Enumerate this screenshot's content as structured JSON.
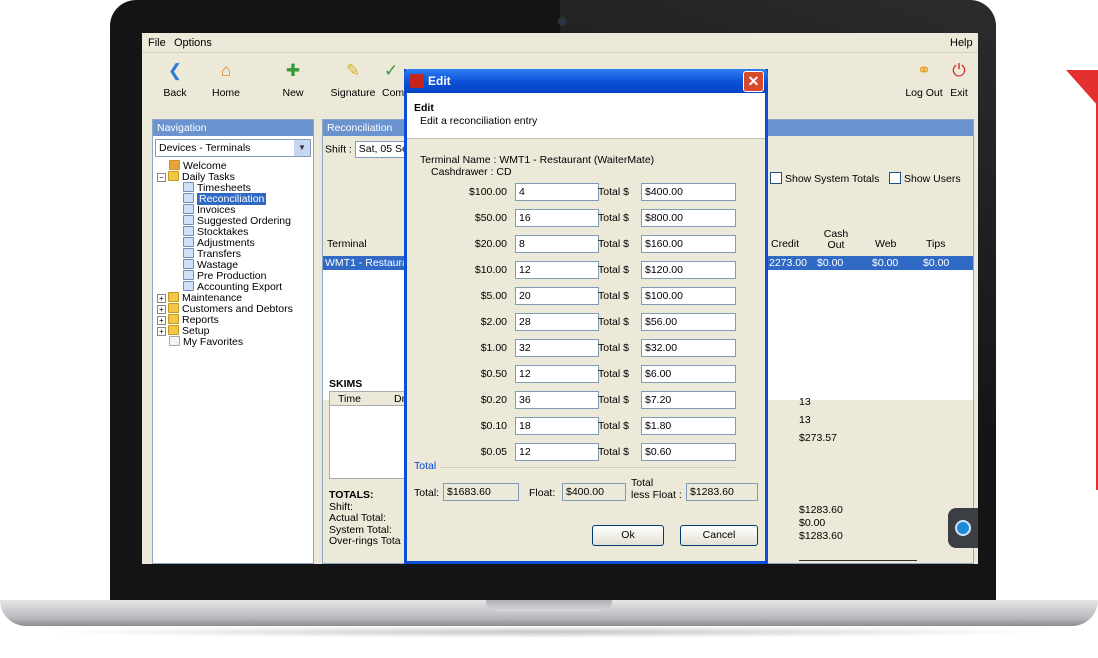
{
  "menubar": {
    "file": "File",
    "options": "Options",
    "help": "Help"
  },
  "toolbar": {
    "back": "Back",
    "home": "Home",
    "new": "New",
    "signature": "Signature",
    "com": "Com",
    "logout": "Log Out",
    "exit": "Exit"
  },
  "nav": {
    "header": "Navigation",
    "dropdown_value": "Devices - Terminals",
    "items": [
      "Welcome",
      "Daily Tasks",
      "Timesheets",
      "Reconciliation",
      "Invoices",
      "Suggested Ordering",
      "Stocktakes",
      "Adjustments",
      "Transfers",
      "Wastage",
      "Pre Production",
      "Accounting Export",
      "Maintenance",
      "Customers and Debtors",
      "Reports",
      "Setup",
      "My Favorites"
    ]
  },
  "recon": {
    "header": "Reconciliation",
    "shift_label": "Shift :",
    "shift_value": "Sat, 05 Se",
    "show_system_totals": "Show System Totals",
    "show_users": "Show Users",
    "columns": {
      "terminal": "Terminal",
      "credit": "Credit",
      "cash_out": "Cash Out",
      "web": "Web",
      "tips": "Tips"
    },
    "row": {
      "terminal": "WMT1 - Restaura",
      "credit": "2273.00",
      "cash_out": "$0.00",
      "web": "$0.00",
      "tips": "$0.00"
    },
    "skims": "SKIMS",
    "skims_cols": {
      "time": "Time",
      "dr": "Dr"
    },
    "totals_title": "TOTALS:",
    "shift": "Shift:",
    "actual_total": "Actual Total:",
    "system_total": "System Total:",
    "over_rings": "Over-rings Tota",
    "right_values": [
      "13",
      "13",
      "$273.57",
      "$1283.60",
      "$0.00",
      "$1283.60"
    ]
  },
  "dialog": {
    "title": "Edit",
    "header_title": "Edit",
    "header_sub": "Edit a reconciliation entry",
    "terminal_name": "Terminal Name : WMT1 - Restaurant (WaiterMate)",
    "cashdrawer": "Cashdrawer : CD",
    "total_prefix": "Total $",
    "denominations": [
      {
        "den": "$100.00",
        "qty": "4",
        "total": "$400.00"
      },
      {
        "den": "$50.00",
        "qty": "16",
        "total": "$800.00"
      },
      {
        "den": "$20.00",
        "qty": "8",
        "total": "$160.00"
      },
      {
        "den": "$10.00",
        "qty": "12",
        "total": "$120.00"
      },
      {
        "den": "$5.00",
        "qty": "20",
        "total": "$100.00"
      },
      {
        "den": "$2.00",
        "qty": "28",
        "total": "$56.00"
      },
      {
        "den": "$1.00",
        "qty": "32",
        "total": "$32.00"
      },
      {
        "den": "$0.50",
        "qty": "12",
        "total": "$6.00"
      },
      {
        "den": "$0.20",
        "qty": "36",
        "total": "$7.20"
      },
      {
        "den": "$0.10",
        "qty": "18",
        "total": "$1.80"
      },
      {
        "den": "$0.05",
        "qty": "12",
        "total": "$0.60"
      }
    ],
    "total_group": "Total",
    "total_label": "Total:",
    "total_value": "$1683.60",
    "float_label": "Float:",
    "float_value": "$400.00",
    "less_float_label_1": "Total",
    "less_float_label_2": "less Float :",
    "less_float_value": "$1283.60",
    "ok": "Ok",
    "cancel": "Cancel"
  }
}
